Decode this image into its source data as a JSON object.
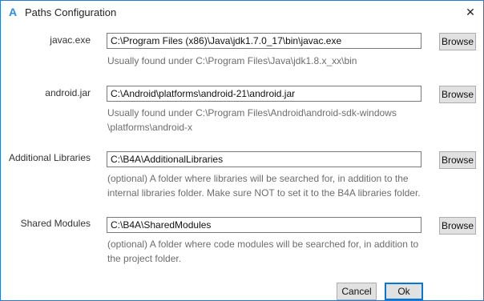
{
  "window": {
    "title": "Paths Configuration",
    "app_icon_glyph": "A",
    "close_glyph": "✕"
  },
  "rows": {
    "javac": {
      "label": "javac.exe",
      "value": "C:\\Program Files (x86)\\Java\\jdk1.7.0_17\\bin\\javac.exe",
      "hint_line1": "Usually found under C:\\Program Files\\Java\\jdk1.8.x_xx\\bin",
      "browse_label": "Browse"
    },
    "android": {
      "label": "android.jar",
      "value": "C:\\Android\\platforms\\android-21\\android.jar",
      "hint_line1": "Usually found under C:\\Program Files\\Android\\android-sdk-windows",
      "hint_line2": "\\platforms\\android-x",
      "browse_label": "Browse"
    },
    "additional": {
      "label": "Additional Libraries",
      "value": "C:\\B4A\\AdditionalLibraries",
      "hint_line1": "(optional) A folder where libraries will be searched for, in addition to the",
      "hint_line2": "internal libraries folder. Make sure NOT to set it to the B4A libraries folder.",
      "browse_label": "Browse"
    },
    "shared": {
      "label": "Shared Modules",
      "value": "C:\\B4A\\SharedModules",
      "hint_line1": "(optional) A folder where code modules will be searched for, in addition to",
      "hint_line2": "the project folder.",
      "browse_label": "Browse"
    }
  },
  "buttons": {
    "cancel": "Cancel",
    "ok": "Ok"
  },
  "colors": {
    "accent": "#0078d7",
    "window_border": "#2b79d0",
    "app_icon": "#2b8ee0",
    "hint_text": "#6d6d6d"
  },
  "icons": {
    "app": "b4a-app-icon",
    "close": "close-icon"
  }
}
